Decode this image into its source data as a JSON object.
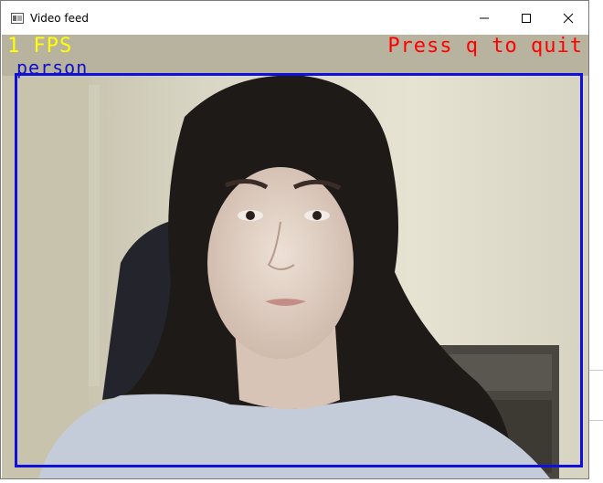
{
  "window": {
    "title": "Video feed",
    "app_icon": "opencv-window-icon",
    "controls": {
      "minimize_icon": "minimize-icon",
      "maximize_icon": "maximize-icon",
      "close_icon": "close-icon"
    }
  },
  "overlay": {
    "fps_text": "1 FPS",
    "quit_text": "Press q to quit",
    "detection_label": "person",
    "colors": {
      "fps": "#ffff00",
      "quit": "#ff0000",
      "bbox": "#1010d8"
    }
  }
}
